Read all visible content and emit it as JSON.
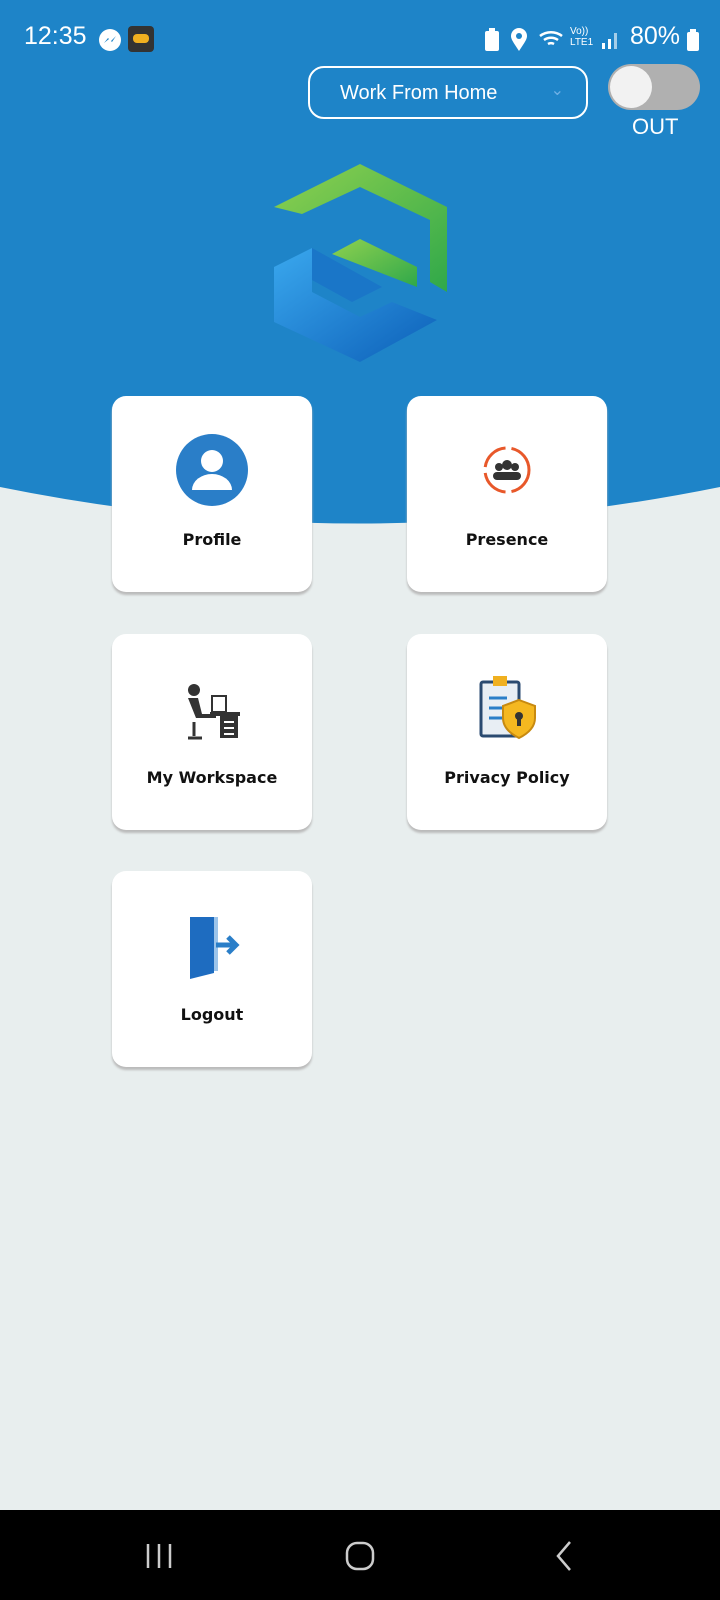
{
  "status_bar": {
    "time": "12:35",
    "battery": "80%",
    "icons": [
      "messenger-icon",
      "app-notification-icon",
      "battery-saver-icon",
      "location-icon",
      "wifi-icon",
      "volte-lte-icon",
      "signal-icon",
      "battery-icon"
    ]
  },
  "work_mode": {
    "selected": "Work From Home"
  },
  "attendance_toggle": {
    "state": "OUT"
  },
  "colors": {
    "header": "#1e84c8",
    "background": "#e8eeee",
    "toggle_off": "#b0b0b0"
  },
  "menu": [
    {
      "label": "Profile",
      "icon": "profile-icon"
    },
    {
      "label": "Presence",
      "icon": "presence-icon"
    },
    {
      "label": "My Workspace",
      "icon": "workspace-icon"
    },
    {
      "label": "Privacy Policy",
      "icon": "privacy-policy-icon"
    },
    {
      "label": "Logout",
      "icon": "logout-icon"
    }
  ],
  "nav_bar": [
    "recent-apps",
    "home",
    "back"
  ]
}
